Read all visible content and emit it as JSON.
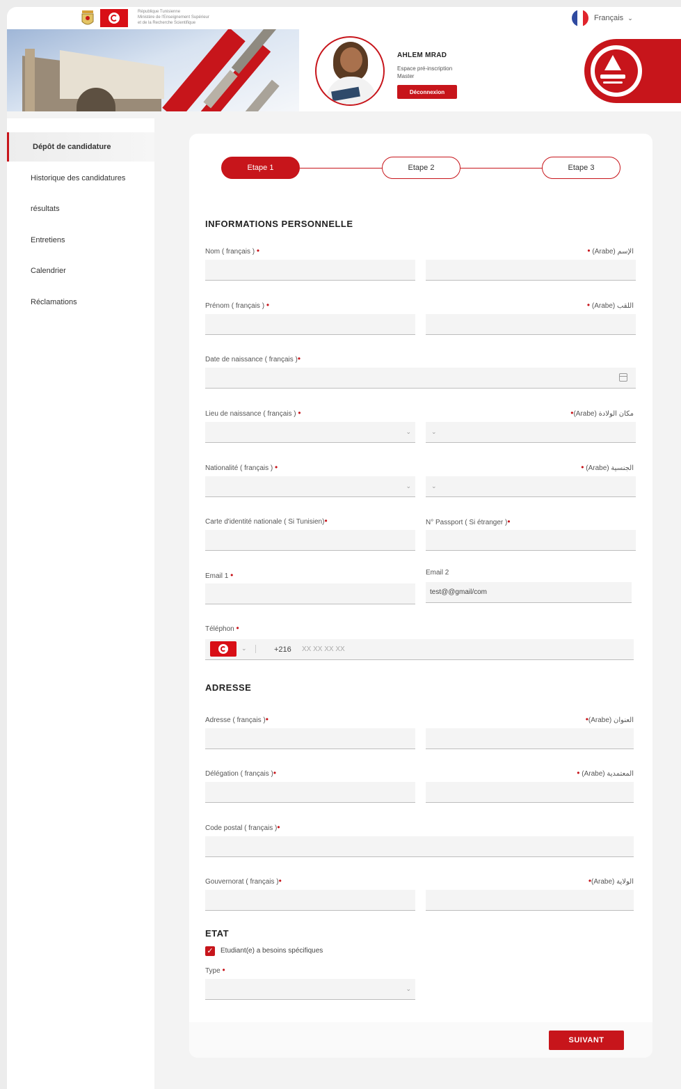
{
  "header": {
    "ministry_lines": [
      "République Tunisienne",
      "Ministère de l'Enseignement Supérieur",
      "et de la Recherche Scientifique"
    ],
    "language": "Français"
  },
  "user": {
    "name": "AHLEM MRAD",
    "space": "Espace pré-inscription",
    "level": "Master",
    "logout": "Déconnexion"
  },
  "sidebar": {
    "items": [
      {
        "label": "Dépôt de candidature"
      },
      {
        "label": "Historique des candidatures"
      },
      {
        "label": "résultats"
      },
      {
        "label": "Entretiens"
      },
      {
        "label": "Calendrier"
      },
      {
        "label": "Réclamations"
      }
    ]
  },
  "steps": [
    "Etape 1",
    "Etape 2",
    "Etape 3"
  ],
  "sections": {
    "personal": "INFORMATIONS PERSONNELLE",
    "address": "ADRESSE",
    "state": "ETAT"
  },
  "labels": {
    "nom_fr": "Nom ( français )",
    "nom_ar": "(Arabe) الإسم",
    "prenom_fr": "Prénom ( français )",
    "prenom_ar": "(Arabe) اللقب",
    "date_naissance": "Date de naissance ( français )",
    "lieu_fr": "Lieu de naissance ( français )",
    "lieu_ar": "(Arabe) مكان الولادة",
    "nat_fr": "Nationalité ( français )",
    "nat_ar": "(Arabe) الجنسية",
    "cin": "Carte d'identité nationale ( Si Tunisien)",
    "passport": "N° Passport ( Si étranger )",
    "email1": "Email 1",
    "email2": "Email 2",
    "telephone": "Téléphon",
    "adresse_fr": "Adresse ( français )",
    "adresse_ar": "(Arabe) العنوان",
    "delegation_fr": "Délégation ( français )",
    "delegation_ar": "(Arabe) المعتمدية",
    "code_postal": "Code postal ( français )",
    "gouv_fr": "Gouvernorat ( français )",
    "gouv_ar": "(Arabe) الولاية",
    "besoins": "Etudiant(e) a besoins spécifiques",
    "type": "Type"
  },
  "values": {
    "email2": "test@@gmail/com",
    "phone_prefix": "+216",
    "phone_placeholder": "XX XX XX XX"
  },
  "actions": {
    "next": "SUIVANT"
  },
  "colors": {
    "accent": "#c7151b"
  }
}
